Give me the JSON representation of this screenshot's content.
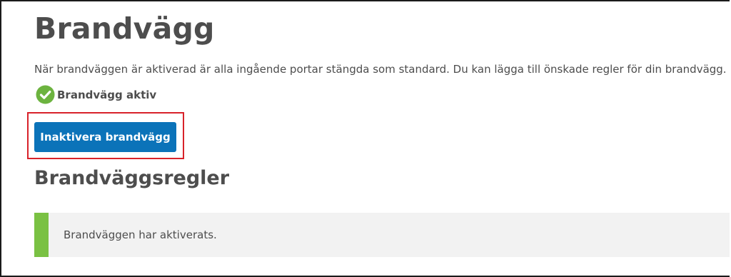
{
  "page": {
    "title": "Brandvägg",
    "description": "När brandväggen är aktiverad är alla ingående portar stängda som standard. Du kan lägga till önskade regler för din brandvägg."
  },
  "status": {
    "icon": "check-circle-icon",
    "icon_color": "#6cb33f",
    "label": "Brandvägg aktiv"
  },
  "actions": {
    "disable_button_label": "Inaktivera brandvägg",
    "button_color": "#0b73b9",
    "highlight_color": "#d8222a"
  },
  "rules_section": {
    "title": "Brandväggsregler"
  },
  "notice": {
    "text": "Brandväggen har aktiverats.",
    "accent_color": "#7ac143",
    "background_color": "#f2f2f2"
  }
}
